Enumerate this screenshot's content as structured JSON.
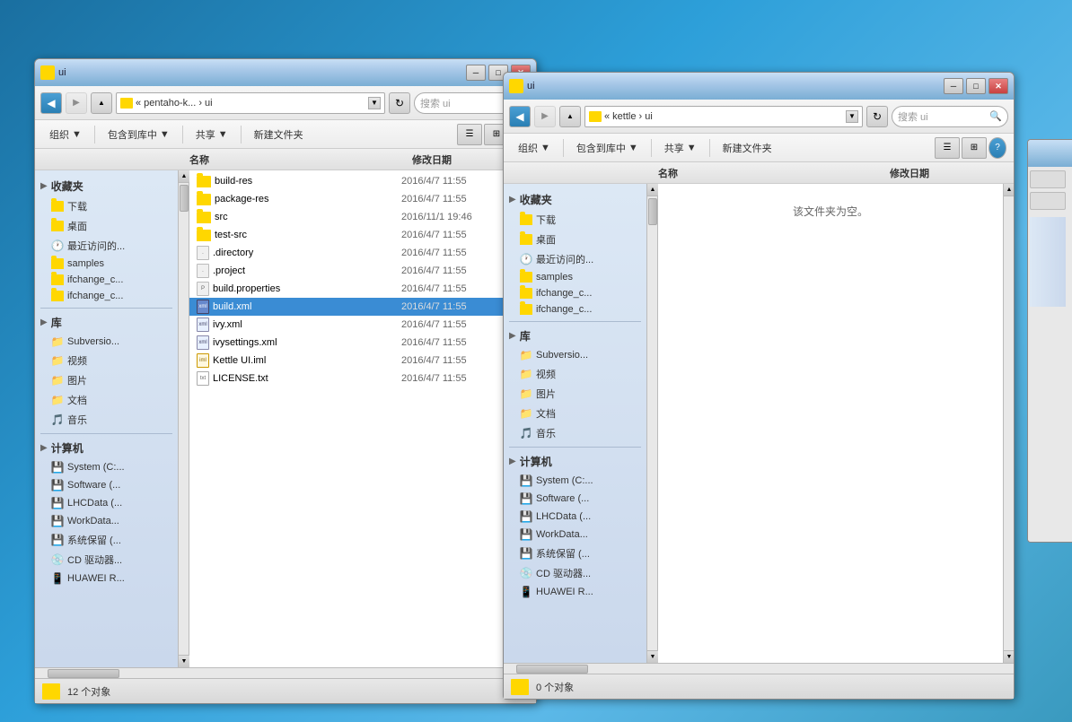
{
  "background": {
    "color": "#2d9fd9"
  },
  "window_left": {
    "title": "ui",
    "address": "« pentaho-k... › ui",
    "search_placeholder": "搜索 ui",
    "toolbar": {
      "organize": "组织",
      "include_in_library": "包含到库中",
      "share": "共享",
      "new_folder": "新建文件夹"
    },
    "columns": {
      "name": "名称",
      "modified": "修改日期"
    },
    "files": [
      {
        "name": "build-res",
        "date": "2016/4/7 11:55",
        "type": "folder"
      },
      {
        "name": "package-res",
        "date": "2016/4/7 11:55",
        "type": "folder"
      },
      {
        "name": "src",
        "date": "2016/11/1 19:46",
        "type": "folder"
      },
      {
        "name": "test-src",
        "date": "2016/4/7 11:55",
        "type": "folder"
      },
      {
        "name": ".directory",
        "date": "2016/4/7 11:55",
        "type": "dot"
      },
      {
        "name": ".project",
        "date": "2016/4/7 11:55",
        "type": "dot"
      },
      {
        "name": "build.properties",
        "date": "2016/4/7 11:55",
        "type": "dot"
      },
      {
        "name": "build.xml",
        "date": "2016/4/7 11:55",
        "type": "xml",
        "selected": true
      },
      {
        "name": "ivy.xml",
        "date": "2016/4/7 11:55",
        "type": "xml"
      },
      {
        "name": "ivysettings.xml",
        "date": "2016/4/7 11:55",
        "type": "xml"
      },
      {
        "name": "Kettle UI.iml",
        "date": "2016/4/7 11:55",
        "type": "iml"
      },
      {
        "name": "LICENSE.txt",
        "date": "2016/4/7 11:55",
        "type": "txt"
      }
    ],
    "sidebar": {
      "sections": [
        {
          "header": "收藏夹",
          "items": [
            {
              "name": "下载",
              "type": "folder"
            },
            {
              "name": "桌面",
              "type": "folder"
            },
            {
              "name": "最近访问的...",
              "type": "clock"
            },
            {
              "name": "samples",
              "type": "folder"
            },
            {
              "name": "ifchange_c...",
              "type": "folder"
            },
            {
              "name": "ifchange_c...",
              "type": "folder"
            }
          ]
        },
        {
          "header": "库",
          "items": [
            {
              "name": "Subversion...",
              "type": "folder"
            },
            {
              "name": "视频",
              "type": "folder"
            },
            {
              "name": "图片",
              "type": "folder"
            },
            {
              "name": "文档",
              "type": "folder"
            },
            {
              "name": "音乐",
              "type": "music"
            }
          ]
        },
        {
          "header": "计算机",
          "items": [
            {
              "name": "System (C:...",
              "type": "drive"
            },
            {
              "name": "Software (...",
              "type": "drive"
            },
            {
              "name": "LHCData (...",
              "type": "drive"
            },
            {
              "name": "WorkData...",
              "type": "drive"
            },
            {
              "name": "系统保留 (...",
              "type": "drive"
            },
            {
              "name": "CD 驱动器...",
              "type": "cd"
            },
            {
              "name": "HUAWEI R...",
              "type": "usb"
            }
          ]
        }
      ]
    },
    "status": "12 个对象"
  },
  "window_right": {
    "title": "ui",
    "address": "« kettle › ui",
    "search_placeholder": "搜索 ui",
    "toolbar": {
      "organize": "组织",
      "include_in_library": "包含到库中",
      "share": "共享",
      "new_folder": "新建文件夹"
    },
    "columns": {
      "name": "名称",
      "modified": "修改日期"
    },
    "empty_text": "该文件夹为空。",
    "sidebar": {
      "sections": [
        {
          "header": "收藏夹",
          "items": [
            {
              "name": "下载",
              "type": "folder"
            },
            {
              "name": "桌面",
              "type": "folder"
            },
            {
              "name": "最近访问的...",
              "type": "clock"
            },
            {
              "name": "samples",
              "type": "folder"
            },
            {
              "name": "ifchange_c...",
              "type": "folder"
            },
            {
              "name": "ifchange_c...",
              "type": "folder"
            }
          ]
        },
        {
          "header": "库",
          "items": [
            {
              "name": "Subversion...",
              "type": "folder"
            },
            {
              "name": "视频",
              "type": "folder"
            },
            {
              "name": "图片",
              "type": "folder"
            },
            {
              "name": "文档",
              "type": "folder"
            },
            {
              "name": "音乐",
              "type": "music"
            }
          ]
        },
        {
          "header": "计算机",
          "items": [
            {
              "name": "System (C:...",
              "type": "drive"
            },
            {
              "name": "Software (...",
              "type": "drive"
            },
            {
              "name": "LHCData (...",
              "type": "drive"
            },
            {
              "name": "WorkData...",
              "type": "drive"
            },
            {
              "name": "系统保留 (...",
              "type": "drive"
            },
            {
              "name": "CD 驱动器...",
              "type": "cd"
            },
            {
              "name": "HUAWEI R...",
              "type": "usb"
            }
          ]
        }
      ]
    },
    "status": "0 个对象"
  }
}
